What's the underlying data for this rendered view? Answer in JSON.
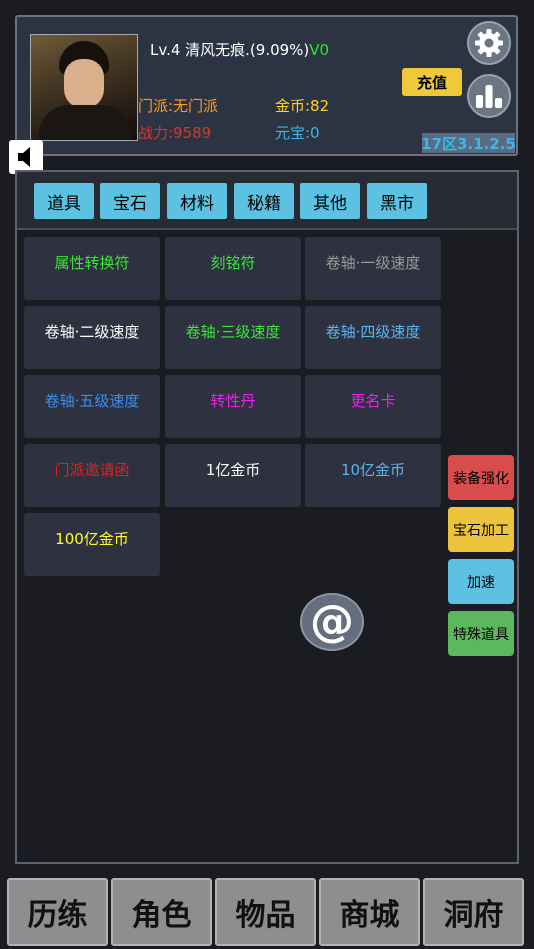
{
  "player": {
    "level_name": "Lv.4 清风无痕.",
    "exp_percent": "(9.09%)",
    "vip": "V0",
    "menpai": "门派:无门派",
    "gold": "金币:82",
    "power": "战力:9589",
    "yuanbao": "元宝:0",
    "version": "17区3.1.2.5"
  },
  "header_buttons": {
    "recharge": "充值",
    "settings_icon": "gear-icon",
    "rank_icon": "bar-chart-icon"
  },
  "tabs": [
    "道具",
    "宝石",
    "材料",
    "秘籍",
    "其他",
    "黑市"
  ],
  "items": [
    {
      "label": "属性转换符",
      "color": "#39e639"
    },
    {
      "label": "刻铭符",
      "color": "#39e639"
    },
    {
      "label": "卷轴·一级速度",
      "color": "#9a9a9a"
    },
    {
      "label": "卷轴·二级速度",
      "color": "#ffffff"
    },
    {
      "label": "卷轴·三级速度",
      "color": "#39e639"
    },
    {
      "label": "卷轴·四级速度",
      "color": "#5ab4f0"
    },
    {
      "label": "卷轴·五级速度",
      "color": "#3a8ef0"
    },
    {
      "label": "转性丹",
      "color": "#ee20ee"
    },
    {
      "label": "更名卡",
      "color": "#ee20ee"
    },
    {
      "label": "门派邀请函",
      "color": "#e02020"
    },
    {
      "label": "1亿金币",
      "color": "#ffffff"
    },
    {
      "label": "10亿金币",
      "color": "#5ab4f0"
    },
    {
      "label": "100亿金币",
      "color": "#ffff30"
    }
  ],
  "side_buttons": [
    {
      "label": "装备强化",
      "color": "#d84c4c"
    },
    {
      "label": "宝石加工",
      "color": "#ecc33c"
    },
    {
      "label": "加速",
      "color": "#5dc1e2"
    },
    {
      "label": "特殊道具",
      "color": "#5cb85c"
    }
  ],
  "chat_button": "@",
  "nav": [
    "历练",
    "角色",
    "物品",
    "商城",
    "洞府"
  ]
}
